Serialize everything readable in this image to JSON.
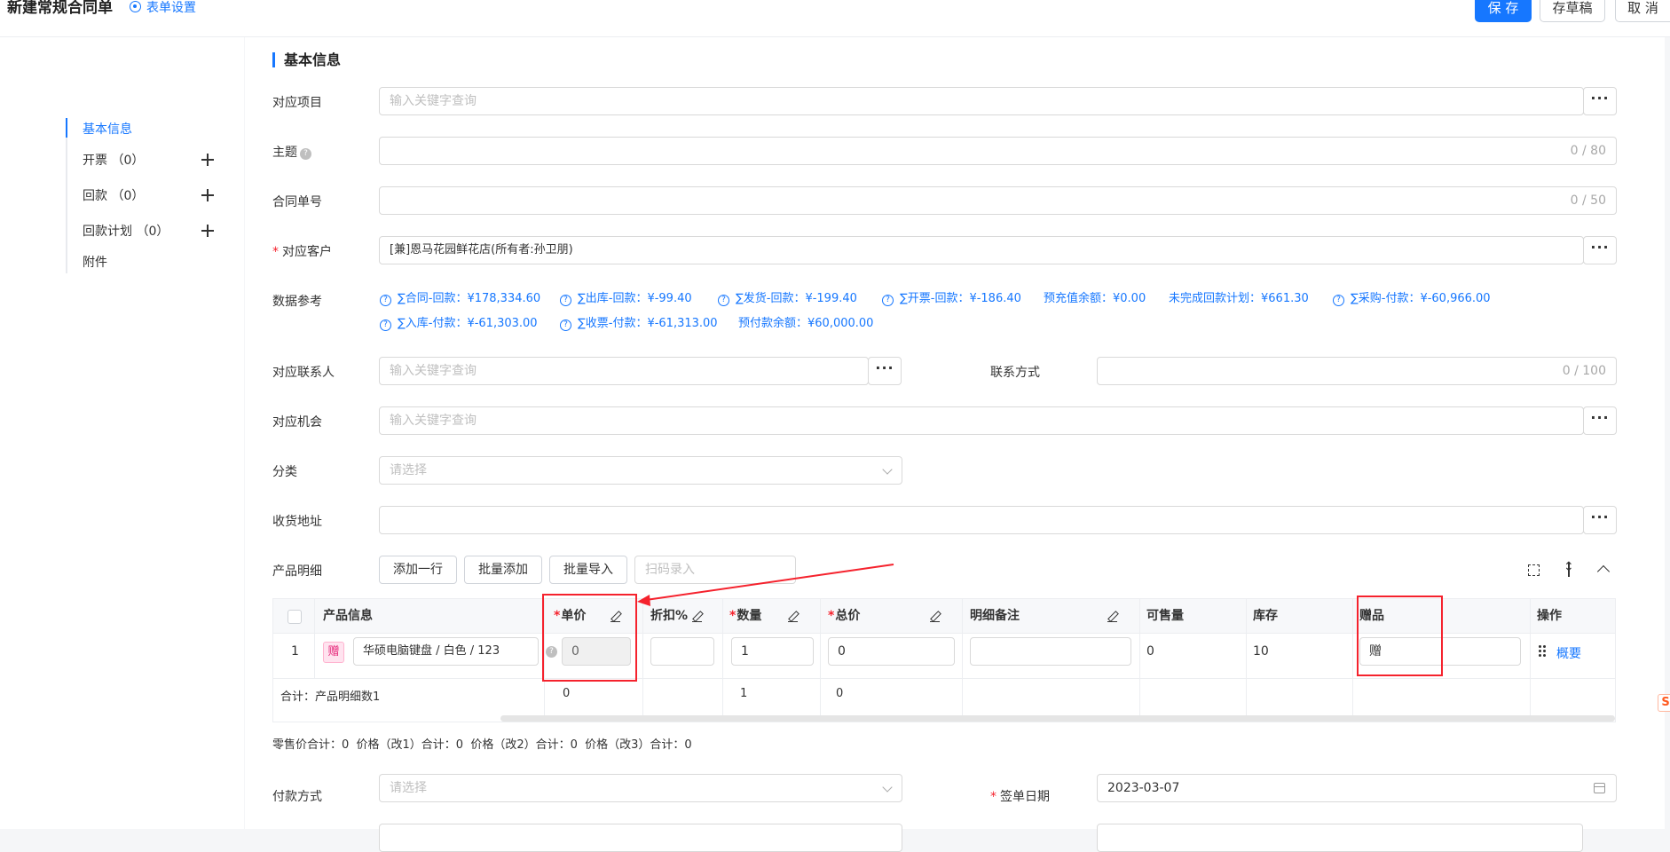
{
  "header": {
    "title": "新建常规合同单",
    "form_settings": "表单设置",
    "save": "保 存",
    "draft": "存草稿",
    "cancel": "取 消"
  },
  "sidebar": {
    "items": [
      {
        "label": "基本信息"
      },
      {
        "label": "开票 （0）"
      },
      {
        "label": "回款 （0）"
      },
      {
        "label": "回款计划 （0）"
      },
      {
        "label": "附件"
      }
    ]
  },
  "section": {
    "title": "基本信息"
  },
  "fields": {
    "project": {
      "label": "对应项目",
      "placeholder": "输入关键字查询"
    },
    "subject": {
      "label": "主题",
      "counter": "0 / 80"
    },
    "contract_no": {
      "label": "合同单号",
      "counter": "0 / 50"
    },
    "customer": {
      "label": "对应客户",
      "required": "*",
      "value": "[兼]恩马花园鲜花店(所有者:孙卫朋)"
    },
    "data_ref": {
      "label": "数据参考"
    },
    "contact": {
      "label": "对应联系人",
      "placeholder": "输入关键字查询"
    },
    "contact_method": {
      "label": "联系方式",
      "counter": "0 / 100"
    },
    "opportunity": {
      "label": "对应机会",
      "placeholder": "输入关键字查询"
    },
    "category": {
      "label": "分类",
      "placeholder": "请选择"
    },
    "address": {
      "label": "收货地址"
    },
    "products": {
      "label": "产品明细"
    },
    "payment": {
      "label": "付款方式",
      "placeholder": "请选择"
    },
    "sign_date": {
      "label": "签单日期",
      "required": "*",
      "value": "2023-03-07"
    }
  },
  "data_refs": [
    {
      "text": "∑合同-回款：¥178,334.60",
      "icon": "question-circle"
    },
    {
      "text": "∑出库-回款：¥-99.40",
      "icon": "question-circle"
    },
    {
      "text": "∑发货-回款：¥-199.40",
      "icon": "question-circle"
    },
    {
      "text": "∑开票-回款：¥-186.40",
      "icon": "question-circle"
    },
    {
      "text": "预充值余额：¥0.00"
    },
    {
      "text": "未完成回款计划：¥661.30"
    },
    {
      "text": "∑采购-付款：¥-60,966.00",
      "icon": "question-circle"
    },
    {
      "text": "∑入库-付款：¥-61,303.00",
      "icon": "question-circle"
    },
    {
      "text": "∑收票-付款：¥-61,313.00",
      "icon": "question-circle"
    },
    {
      "text": "预付款余额：¥60,000.00"
    }
  ],
  "product_toolbar": {
    "add_row": "添加一行",
    "batch_add": "批量添加",
    "batch_import": "批量导入",
    "scan_placeholder": "扫码录入"
  },
  "table": {
    "headers": {
      "product_info": "产品信息",
      "unit_price": "单价",
      "discount": "折扣%",
      "quantity": "数量",
      "total": "总价",
      "remark": "明细备注",
      "available": "可售量",
      "stock": "库存",
      "gift": "赠品",
      "action": "操作"
    },
    "required_mark": "*",
    "rows": [
      {
        "index": "1",
        "gift_tag": "赠",
        "product": "华硕电脑键盘 / 白色 / 123",
        "unit_price": "0",
        "discount": "",
        "quantity": "1",
        "total": "0",
        "remark": "",
        "available": "0",
        "stock": "10",
        "gift": "赠",
        "action": "概要"
      }
    ],
    "totals": {
      "label": "合计：产品明细数1",
      "unit_price": "0",
      "quantity": "1",
      "total": "0"
    }
  },
  "summary": "零售价合计：0  价格（改1）合计：0  价格（改2）合计：0  价格（改3）合计：0",
  "colors": {
    "accent": "#1677ff",
    "annotation": "#f5222d"
  }
}
